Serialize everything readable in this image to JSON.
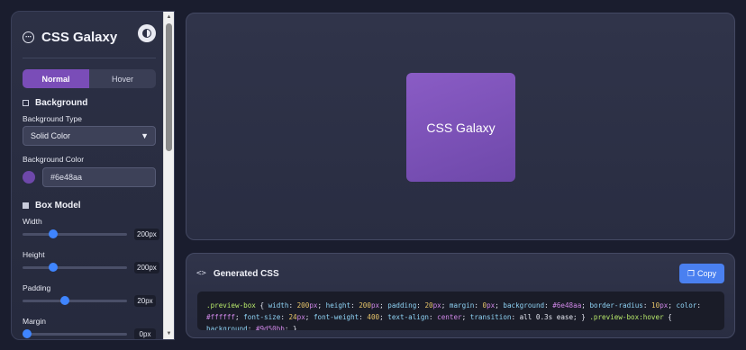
{
  "sidebar": {
    "title": "CSS Galaxy",
    "logo_icon": "galaxy-icon",
    "theme_toggle_icon": "half-moon-icon",
    "tabs": [
      {
        "label": "Normal",
        "active": true
      },
      {
        "label": "Hover",
        "active": false
      }
    ],
    "background_section": {
      "title": "Background",
      "type_label": "Background Type",
      "type_value": "Solid Color",
      "color_label": "Background Color",
      "color_value": "#6e48aa",
      "swatch_color": "#6e48aa"
    },
    "box_model_section": {
      "title": "Box Model",
      "sliders": [
        {
          "label": "Width",
          "value": "200px",
          "fraction": 0.27
        },
        {
          "label": "Height",
          "value": "200px",
          "fraction": 0.27
        },
        {
          "label": "Padding",
          "value": "20px",
          "fraction": 0.4
        },
        {
          "label": "Margin",
          "value": "0px",
          "fraction": 0.0
        }
      ]
    }
  },
  "preview": {
    "box_text": "CSS Galaxy"
  },
  "code_panel": {
    "title": "Generated CSS",
    "copy_label": "Copy",
    "copy_icon": "copy-icon",
    "code_icon": "code-icon"
  },
  "colors": {
    "accent": "#6e48aa",
    "button_blue": "#4a80f0",
    "slider_thumb": "#3f85ff",
    "hover_bg": "#9d50bb"
  }
}
